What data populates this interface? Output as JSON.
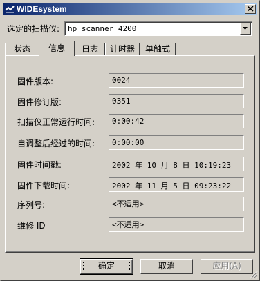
{
  "window": {
    "title": "WIDEsystem"
  },
  "scanner": {
    "label": "选定的扫描仪:",
    "selected": "hp scanner 4200"
  },
  "tabs": [
    {
      "label": "状态",
      "active": false
    },
    {
      "label": "信息",
      "active": true
    },
    {
      "label": "日志",
      "active": false
    },
    {
      "label": "计时器",
      "active": false
    },
    {
      "label": "单触式",
      "active": false
    }
  ],
  "info": {
    "rows": [
      {
        "label": "固件版本:",
        "value": "0024"
      },
      {
        "label": "固件修订版:",
        "value": "0351"
      },
      {
        "label": "扫描仪正常运行时间:",
        "value": "0:00:42"
      },
      {
        "label": "自调整后经过的时间:",
        "value": "0:00:00"
      },
      {
        "label": "固件时间戳:",
        "value": "2002 年 10 月 8 日 10:19:23"
      },
      {
        "label": "固件下载时间:",
        "value": "2002 年 11 月 5 日 09:23:22"
      },
      {
        "label": "序列号:",
        "value": "<不适用>"
      },
      {
        "label": "维修 ID",
        "value": "<不适用>"
      }
    ]
  },
  "buttons": {
    "ok": "确定",
    "cancel": "取消",
    "apply": "应用(A)"
  }
}
